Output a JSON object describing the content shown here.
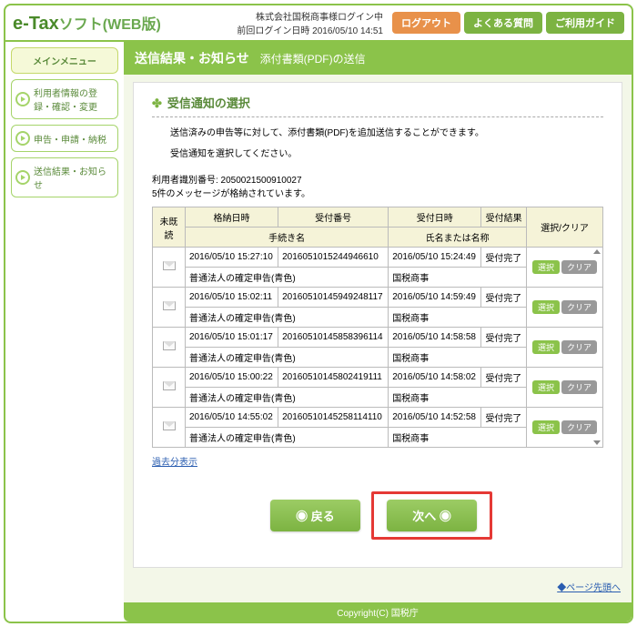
{
  "header": {
    "logo_e": "e-",
    "logo_tax": "Tax",
    "logo_soft": "ソフト",
    "logo_web": "(WEB版)",
    "company": "株式会社国税商事様ログイン中",
    "last_login_label": "前回ログイン日時",
    "last_login": "2016/05/10 14:51",
    "logout": "ログアウト",
    "faq": "よくある質問",
    "guide": "ご利用ガイド"
  },
  "sidebar": {
    "main_menu": "メインメニュー",
    "items": [
      "利用者情報の登録・確認・変更",
      "申告・申請・納税",
      "送信結果・お知らせ"
    ]
  },
  "page": {
    "title": "送信結果・お知らせ",
    "subtitle": "添付書類(PDF)の送信",
    "section_title": "受信通知の選択",
    "desc1": "送信済みの申告等に対して、添付書類(PDF)を追加送信することができます。",
    "desc2": "受信通知を選択してください。",
    "meta1": "利用者識別番号: 2050021500910027",
    "meta2": "5件のメッセージが格納されています。"
  },
  "table": {
    "h_unread": "未既読",
    "h_storedate": "格納日時",
    "h_recno": "受付番号",
    "h_recdate": "受付日時",
    "h_recresult": "受付結果",
    "h_proc": "手続き名",
    "h_name": "氏名または名称",
    "h_action": "選択/クリア",
    "btn_select": "選択",
    "btn_clear": "クリア",
    "rows": [
      {
        "stored": "2016/05/10 15:27:10",
        "recno": "2016051015244946610",
        "recdate": "2016/05/10 15:24:49",
        "result": "受付完了",
        "proc": "普通法人の確定申告(青色)",
        "name": "国税商事"
      },
      {
        "stored": "2016/05/10 15:02:11",
        "recno": "20160510145949248117",
        "recdate": "2016/05/10 14:59:49",
        "result": "受付完了",
        "proc": "普通法人の確定申告(青色)",
        "name": "国税商事"
      },
      {
        "stored": "2016/05/10 15:01:17",
        "recno": "20160510145858396114",
        "recdate": "2016/05/10 14:58:58",
        "result": "受付完了",
        "proc": "普通法人の確定申告(青色)",
        "name": "国税商事"
      },
      {
        "stored": "2016/05/10 15:00:22",
        "recno": "20160510145802419111",
        "recdate": "2016/05/10 14:58:02",
        "result": "受付完了",
        "proc": "普通法人の確定申告(青色)",
        "name": "国税商事"
      },
      {
        "stored": "2016/05/10 14:55:02",
        "recno": "20160510145258114110",
        "recdate": "2016/05/10 14:52:58",
        "result": "受付完了",
        "proc": "普通法人の確定申告(青色)",
        "name": "国税商事"
      }
    ],
    "past_link": "過去分表示"
  },
  "buttons": {
    "back": "◉ 戻る",
    "next": "次へ ◉"
  },
  "pagetop": "◆ページ先頭へ",
  "footer": "Copyright(C) 国税庁"
}
